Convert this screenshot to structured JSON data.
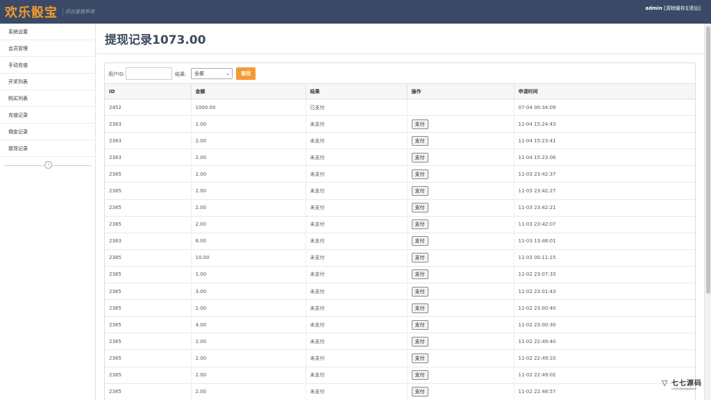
{
  "header": {
    "logo": "欢乐骰宝",
    "subtitle": "后台管理系统",
    "user": "admin",
    "links": [
      "[清除缓存]",
      "[退出]"
    ]
  },
  "sidebar": {
    "items": [
      "系统设置",
      "会员管理",
      "手动充值",
      "开奖列表",
      "购买列表",
      "充值记录",
      "佣金记录",
      "提现记录"
    ],
    "collapse_icon": "chevron-left-icon"
  },
  "main": {
    "title": "提现记录1073.00",
    "filter": {
      "user_id_label": "用户ID:",
      "user_id_value": "",
      "result_label": "结果:",
      "result_selected": "全部",
      "search_label": "查找"
    },
    "table": {
      "headers": [
        "ID",
        "金额",
        "结果",
        "操作",
        "申请时间"
      ],
      "pay_label": "支付",
      "rows": [
        {
          "id": "2452",
          "amount": "1000.00",
          "status": "已支付",
          "action": "",
          "time": "07-04 00:34:09"
        },
        {
          "id": "2383",
          "amount": "2.00",
          "status": "未支付",
          "action": "支付",
          "time": "11-04 15:24:43"
        },
        {
          "id": "2383",
          "amount": "2.00",
          "status": "未支付",
          "action": "支付",
          "time": "11-04 15:23:41"
        },
        {
          "id": "2383",
          "amount": "2.00",
          "status": "未支付",
          "action": "支付",
          "time": "11-04 15:23:06"
        },
        {
          "id": "2385",
          "amount": "2.00",
          "status": "未支付",
          "action": "支付",
          "time": "11-03 23:42:37"
        },
        {
          "id": "2385",
          "amount": "2.00",
          "status": "未支付",
          "action": "支付",
          "time": "11-03 23:42:27"
        },
        {
          "id": "2385",
          "amount": "2.00",
          "status": "未支付",
          "action": "支付",
          "time": "11-03 23:42:21"
        },
        {
          "id": "2385",
          "amount": "2.00",
          "status": "未支付",
          "action": "支付",
          "time": "11-03 23:42:07"
        },
        {
          "id": "2383",
          "amount": "6.00",
          "status": "未支付",
          "action": "支付",
          "time": "11-03 13:48:01"
        },
        {
          "id": "2385",
          "amount": "10.00",
          "status": "未支付",
          "action": "支付",
          "time": "11-03 00:11:15"
        },
        {
          "id": "2385",
          "amount": "1.00",
          "status": "未支付",
          "action": "支付",
          "time": "11-02 23:07:33"
        },
        {
          "id": "2385",
          "amount": "3.00",
          "status": "未支付",
          "action": "支付",
          "time": "11-02 23:01:43"
        },
        {
          "id": "2385",
          "amount": "2.00",
          "status": "未支付",
          "action": "支付",
          "time": "11-02 23:00:40"
        },
        {
          "id": "2385",
          "amount": "4.00",
          "status": "未支付",
          "action": "支付",
          "time": "11-02 23:00:30"
        },
        {
          "id": "2385",
          "amount": "2.00",
          "status": "未支付",
          "action": "支付",
          "time": "11-02 22:49:40"
        },
        {
          "id": "2385",
          "amount": "2.00",
          "status": "未支付",
          "action": "支付",
          "time": "11-02 22:49:10"
        },
        {
          "id": "2385",
          "amount": "2.00",
          "status": "未支付",
          "action": "支付",
          "time": "11-02 22:49:02"
        },
        {
          "id": "2385",
          "amount": "2.00",
          "status": "未支付",
          "action": "支付",
          "time": "11-02 22:48:57"
        }
      ]
    }
  },
  "watermark": {
    "text": "七七源码",
    "sub": "分享有价值的优质源码资源"
  },
  "colors": {
    "header_bg": "#3a4a66",
    "logo": "#f39a2e",
    "search_button": "#f59a33"
  }
}
